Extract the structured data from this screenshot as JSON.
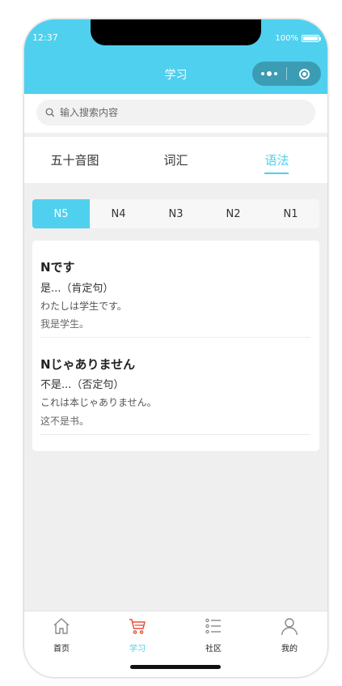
{
  "status_bar": {
    "time": "12:37",
    "battery": "100%"
  },
  "nav": {
    "title": "学习"
  },
  "search": {
    "placeholder": "输入搜索内容"
  },
  "tabs": [
    {
      "label": "五十音图",
      "active": false
    },
    {
      "label": "词汇",
      "active": false
    },
    {
      "label": "语法",
      "active": true
    }
  ],
  "levels": [
    {
      "label": "N5",
      "active": true
    },
    {
      "label": "N4",
      "active": false
    },
    {
      "label": "N3",
      "active": false
    },
    {
      "label": "N2",
      "active": false
    },
    {
      "label": "N1",
      "active": false
    }
  ],
  "grammar": [
    {
      "title": "Nです",
      "meaning": "是...（肯定句）",
      "example": "わたしは学生です。",
      "translation": "我是学生。"
    },
    {
      "title": "Nじゃありません",
      "meaning": "不是...（否定句）",
      "example": "これは本じゃありません。",
      "translation": "这不是书。"
    }
  ],
  "tabbar": [
    {
      "label": "首页",
      "icon": "home-icon",
      "active": false
    },
    {
      "label": "学习",
      "icon": "cart-icon",
      "active": true
    },
    {
      "label": "社区",
      "icon": "list-icon",
      "active": false
    },
    {
      "label": "我的",
      "icon": "user-icon",
      "active": false
    }
  ],
  "colors": {
    "accent": "#4fd0ef",
    "cart_icon": "#e8503a"
  }
}
